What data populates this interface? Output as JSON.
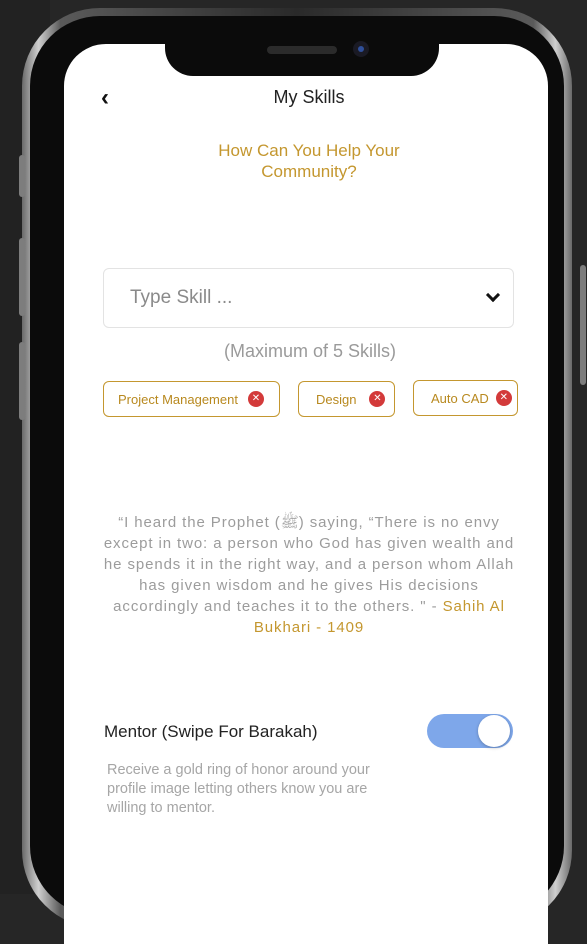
{
  "header": {
    "title": "My Skills",
    "back_icon": "chevron-left-icon"
  },
  "subtitle": "How Can You Help Your Community?",
  "skill_input": {
    "placeholder": "Type Skill ...",
    "value": "",
    "dropdown_icon": "chevron-down-icon"
  },
  "max_note": "(Maximum of 5 Skills)",
  "skills": [
    {
      "label": "Project Management"
    },
    {
      "label": "Design"
    },
    {
      "label": "Auto CAD"
    }
  ],
  "quote": {
    "text": "“I heard the Prophet (ﷺ) saying, “There is no envy except in two: a person who God has given wealth and he spends it in the right way, and a person whom Allah has given wisdom and he gives His decisions accordingly and teaches it to the others. \" - ",
    "source": "Sahih Al Bukhari - 1409"
  },
  "mentor": {
    "label": "Mentor (Swipe For Barakah)",
    "enabled": true,
    "description": "Receive a gold ring of honor around your profile image letting others know you are willing to mentor."
  },
  "colors": {
    "accent_gold": "#c4972f",
    "remove_red": "#d33a3a",
    "toggle_on": "#7ea7ea",
    "background": "#262626"
  }
}
